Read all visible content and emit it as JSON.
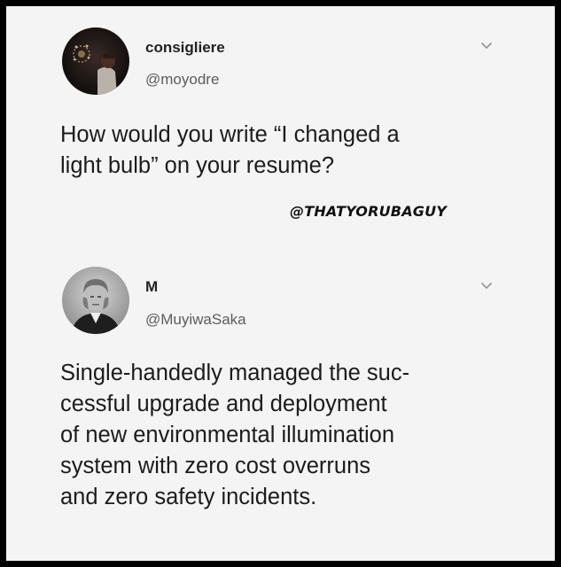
{
  "tweets": [
    {
      "display_name": "consigliere",
      "handle": "@moyodre",
      "text_lines": [
        "How would you write “I changed a",
        "light bulb” on your resume?"
      ],
      "avatar_icon": "profile-photo-person-fireworks"
    },
    {
      "display_name": "M",
      "handle": "@MuyiwaSaka",
      "text_lines": [
        "Single-handedly managed the suc-",
        "cessful upgrade and deployment",
        "of new environmental illumination",
        "system with zero cost overruns",
        "and zero safety incidents."
      ],
      "avatar_icon": "profile-photo-vintage-portrait"
    }
  ],
  "watermark": "@THATYORUBAGUY",
  "chevron_icon": "chevron-down-icon",
  "colors": {
    "border": "#000000",
    "background": "#f4f4f4",
    "text": "#1c1c1c",
    "handle": "#5c5c5c",
    "chevron": "#9a9a9a"
  }
}
